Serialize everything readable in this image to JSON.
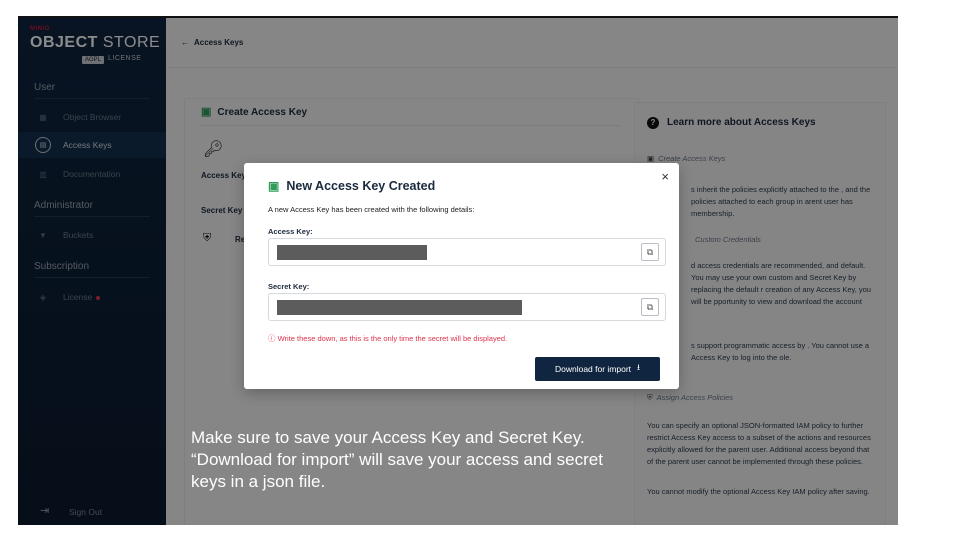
{
  "sidebar": {
    "logo": {
      "small": "MINIO",
      "brand_bold": "OBJECT",
      "brand_light": " STORE",
      "agpl": "AGPL",
      "license": "LICENSE"
    },
    "sections": [
      {
        "label": "User"
      },
      {
        "label": "Administrator"
      },
      {
        "label": "Subscription"
      }
    ],
    "items": [
      {
        "label": "Object Browser",
        "icon": "grid-icon"
      },
      {
        "label": "Access Keys",
        "icon": "key-card-icon"
      },
      {
        "label": "Documentation",
        "icon": "doc-icon"
      },
      {
        "label": "Buckets",
        "icon": "bucket-icon"
      },
      {
        "label": "License",
        "icon": "license-icon"
      }
    ],
    "signout": "Sign Out"
  },
  "header": {
    "back_label": "Access Keys"
  },
  "main": {
    "card_title": "Create Access Key",
    "label_access": "Access Key",
    "label_secret": "Secret Key",
    "label_re": "Re"
  },
  "side": {
    "title": "Learn more about Access Keys",
    "sub1": "Create Access Keys",
    "p1": "s inherit the policies explicitly attached to the , and the policies attached to each group in arent user has membership.",
    "sub2": "Custom Credentials",
    "p2": "d access credentials are recommended, and default. You may use your own custom and Secret Key by replacing the default r creation of any Access Key, you will be pportunity to view and download the account",
    "p3": "s support programmatic access by . You cannot use a Access Key to log into the ole.",
    "sub3": "Assign Access Policies",
    "p4": "You can specify an optional JSON-formatted IAM policy to further restrict Access Key access to a subset of the actions and resources explicitly allowed for the parent user. Additional access beyond that of the parent user cannot be implemented through these policies.",
    "p5": "You cannot modify the optional Access Key IAM policy after saving."
  },
  "modal": {
    "title": "New Access Key Created",
    "description": "A new Access Key has been created with the following details:",
    "access_label": "Access Key:",
    "secret_label": "Secret Key:",
    "warning": "Write these down, as this is the only time the secret will be displayed.",
    "download_label": "Download for import",
    "close": "×"
  },
  "caption": "Make sure to save your Access Key and Secret Key. “Download for import” will save your access and secret keys in a json file.",
  "colors": {
    "accent_navy": "#0f2540",
    "warning_red": "#e0334c",
    "success_green": "#2f9c5a"
  }
}
